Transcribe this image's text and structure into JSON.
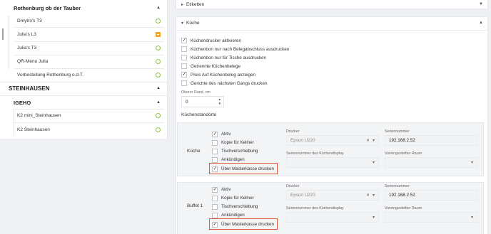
{
  "sidebar": {
    "groups": [
      {
        "label": "Rothenburg ob der Tauber"
      },
      {
        "label": "STEINHAUSEN"
      },
      {
        "label": "IGEHO"
      }
    ],
    "venues": [
      {
        "label": "Dmytro's T3",
        "status": "circle"
      },
      {
        "label": "Julia's L3",
        "status": "square"
      },
      {
        "label": "Julia's T3",
        "status": "circle"
      },
      {
        "label": "QR-Menu Julia",
        "status": "circle"
      },
      {
        "label": "Vorbestellung Rothenburg o.d.T.",
        "status": "circle"
      },
      {
        "label": "K2 mini_Steinhausen",
        "status": "circle"
      },
      {
        "label": "K2 Steinhausen",
        "status": "circle"
      }
    ]
  },
  "main": {
    "sections": {
      "etiketten": "Etiketten",
      "kueche": "Küche"
    },
    "options": [
      {
        "label": "Küchendrucker aktivieren",
        "checked": true
      },
      {
        "label": "Küchenbon nur nach Belegabschluss ausdrucken",
        "checked": false
      },
      {
        "label": "Küchenbon nur für Tische ausdrucken",
        "checked": false
      },
      {
        "label": "Getrennte Küchenbelege",
        "checked": false
      },
      {
        "label": "Preis Auf Küchenbeleg anzeigen",
        "checked": true
      },
      {
        "label": "Gerichte des nächsten Gangs drucken",
        "checked": false
      }
    ],
    "top_margin": {
      "label": "Oberer Rand, cm",
      "value": "0"
    },
    "locations_title": "Küchenstandorte",
    "labels": {
      "drucker": "Drucker",
      "seriennummer": "Seriennummer",
      "display_serial": "Seriennummer des Küchendisplay",
      "default_room": "Voreingestellter Raum"
    },
    "locations": [
      {
        "name": "Küche",
        "printer": "Epson U220",
        "serial": "192.168.2.52",
        "options": [
          {
            "label": "Aktiv",
            "checked": true
          },
          {
            "label": "Kopie für Kellner",
            "checked": false
          },
          {
            "label": "Tischverschiebung",
            "checked": false
          },
          {
            "label": "Ankündigen",
            "checked": false
          },
          {
            "label": "Über Masterkasse drucken",
            "checked": true
          }
        ]
      },
      {
        "name": "Buffet 1",
        "printer": "Epson U220",
        "serial": "192.168.2.52",
        "options": [
          {
            "label": "Aktiv",
            "checked": true
          },
          {
            "label": "Kopie für Kellner",
            "checked": false
          },
          {
            "label": "Tischverschiebung",
            "checked": false
          },
          {
            "label": "Ankündigen",
            "checked": false
          },
          {
            "label": "Über Masterkasse drucken",
            "checked": true
          }
        ]
      }
    ]
  },
  "colors": {
    "status_green": "#8bc34a",
    "status_orange": "#f5a623",
    "highlight_red": "#e05a3f"
  }
}
